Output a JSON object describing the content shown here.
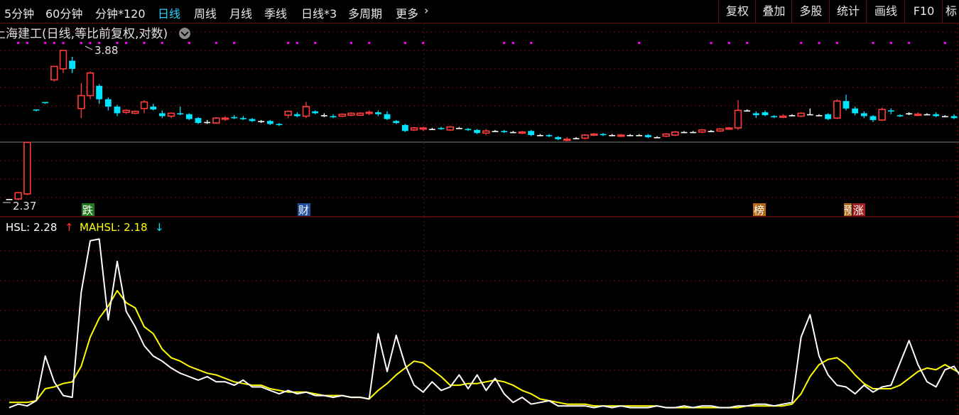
{
  "toolbar": {
    "periods": [
      "5分钟",
      "60分钟",
      "分钟*120",
      "日线",
      "周线",
      "月线",
      "季线",
      "日线*3",
      "多周期",
      "更多"
    ],
    "active": "日线",
    "more_chevron": "chevron-right-icon",
    "right_buttons": [
      "复权",
      "叠加",
      "多股",
      "统计",
      "画线",
      "F10",
      "标"
    ]
  },
  "price_panel": {
    "title": "上海建工(日线,等比前复权,对数)",
    "title_menu_icon": "chevron-down-icon",
    "high_label": "3.88",
    "low_label": "2.37",
    "markers": [
      {
        "text": "跌",
        "bg": "#1f7a1f"
      },
      {
        "text": "财",
        "bg": "#1f4f9a"
      },
      {
        "text": "榜",
        "bg": "#b06a1a"
      },
      {
        "text": "预",
        "bg": "#b06a1a"
      },
      {
        "text": "涨",
        "bg": "#a02020"
      }
    ]
  },
  "indicator_panel": {
    "hsl_label": "HSL: 2.28",
    "hsl_arrow": "↑",
    "mahsl_label": "MAHSL: 2.18",
    "mahsl_arrow": "↓"
  },
  "colors": {
    "up": "#ff3c3c",
    "down": "#00e5ff",
    "flat": "#ffffff",
    "hsl": "#ffffff",
    "mahsl": "#ffff00",
    "grid": "#7a0c0c",
    "dot": "#ff00ff"
  },
  "chart_data": {
    "type": "candlestick",
    "candles": [
      [
        2.37,
        2.37,
        2.37,
        2.37
      ],
      [
        2.37,
        2.42,
        2.36,
        2.41
      ],
      [
        2.41,
        2.86,
        2.4,
        2.86
      ],
      [
        3.19,
        3.18,
        3.17,
        3.19
      ],
      [
        3.27,
        3.26,
        3.25,
        3.27
      ],
      [
        3.52,
        3.68,
        3.5,
        3.65
      ],
      [
        3.65,
        3.88,
        3.6,
        3.84
      ],
      [
        3.75,
        3.65,
        3.6,
        3.8
      ],
      [
        3.2,
        3.34,
        3.1,
        3.48
      ],
      [
        3.34,
        3.6,
        3.3,
        3.62
      ],
      [
        3.45,
        3.3,
        3.25,
        3.47
      ],
      [
        3.3,
        3.22,
        3.18,
        3.32
      ],
      [
        3.22,
        3.15,
        3.12,
        3.24
      ],
      [
        3.16,
        3.18,
        3.14,
        3.19
      ],
      [
        3.15,
        3.17,
        3.14,
        3.18
      ],
      [
        3.2,
        3.27,
        3.15,
        3.29
      ],
      [
        3.22,
        3.19,
        3.18,
        3.25
      ],
      [
        3.15,
        3.12,
        3.1,
        3.18
      ],
      [
        3.12,
        3.15,
        3.1,
        3.16
      ],
      [
        3.15,
        3.14,
        3.13,
        3.22
      ],
      [
        3.14,
        3.09,
        3.08,
        3.15
      ],
      [
        3.1,
        3.05,
        3.04,
        3.11
      ],
      [
        3.06,
        3.06,
        3.04,
        3.08
      ],
      [
        3.05,
        3.1,
        3.04,
        3.11
      ],
      [
        3.09,
        3.1,
        3.07,
        3.12
      ],
      [
        3.11,
        3.1,
        3.09,
        3.13
      ],
      [
        3.1,
        3.09,
        3.08,
        3.12
      ],
      [
        3.09,
        3.07,
        3.06,
        3.1
      ],
      [
        3.07,
        3.07,
        3.05,
        3.08
      ],
      [
        3.07,
        3.04,
        3.03,
        3.08
      ],
      [
        3.04,
        3.03,
        3.02,
        3.05
      ],
      [
        3.13,
        3.17,
        3.1,
        3.18
      ],
      [
        3.14,
        3.12,
        3.11,
        3.16
      ],
      [
        3.12,
        3.22,
        3.1,
        3.27
      ],
      [
        3.17,
        3.15,
        3.14,
        3.18
      ],
      [
        3.13,
        3.13,
        3.11,
        3.15
      ],
      [
        3.12,
        3.11,
        3.1,
        3.14
      ],
      [
        3.12,
        3.14,
        3.11,
        3.15
      ],
      [
        3.13,
        3.15,
        3.12,
        3.16
      ],
      [
        3.13,
        3.15,
        3.12,
        3.16
      ],
      [
        3.15,
        3.16,
        3.13,
        3.18
      ],
      [
        3.16,
        3.14,
        3.12,
        3.18
      ],
      [
        3.14,
        3.09,
        3.08,
        3.17
      ],
      [
        3.07,
        3.05,
        3.04,
        3.08
      ],
      [
        3.03,
        2.97,
        2.96,
        3.04
      ],
      [
        2.98,
        3.0,
        2.97,
        3.01
      ],
      [
        2.99,
        3.0,
        2.97,
        3.01
      ],
      [
        2.99,
        2.99,
        2.98,
        3.0
      ],
      [
        3.0,
        2.99,
        2.98,
        3.01
      ],
      [
        2.98,
        3.01,
        2.97,
        3.02
      ],
      [
        3.0,
        3.0,
        2.99,
        3.01
      ],
      [
        2.99,
        2.98,
        2.97,
        3.0
      ],
      [
        2.98,
        2.95,
        2.94,
        2.99
      ],
      [
        2.95,
        2.97,
        2.93,
        2.99
      ],
      [
        2.97,
        2.97,
        2.96,
        2.98
      ],
      [
        2.97,
        2.96,
        2.95,
        2.98
      ],
      [
        2.96,
        2.96,
        2.95,
        2.97
      ],
      [
        2.95,
        2.96,
        2.94,
        2.97
      ],
      [
        2.97,
        2.93,
        2.92,
        2.98
      ],
      [
        2.93,
        2.93,
        2.92,
        2.94
      ],
      [
        2.93,
        2.92,
        2.91,
        2.94
      ],
      [
        2.91,
        2.89,
        2.88,
        2.92
      ],
      [
        2.88,
        2.89,
        2.87,
        2.91
      ],
      [
        2.9,
        2.9,
        2.89,
        2.91
      ],
      [
        2.9,
        2.93,
        2.89,
        2.94
      ],
      [
        2.93,
        2.94,
        2.92,
        2.95
      ],
      [
        2.94,
        2.93,
        2.92,
        2.95
      ],
      [
        2.93,
        2.93,
        2.92,
        2.94
      ],
      [
        2.92,
        2.93,
        2.91,
        2.94
      ],
      [
        2.93,
        2.93,
        2.92,
        2.94
      ],
      [
        2.93,
        2.93,
        2.92,
        2.94
      ],
      [
        2.93,
        2.91,
        2.9,
        2.94
      ],
      [
        2.91,
        2.91,
        2.9,
        2.92
      ],
      [
        2.92,
        2.94,
        2.91,
        2.95
      ],
      [
        2.93,
        2.96,
        2.92,
        2.97
      ],
      [
        2.96,
        2.96,
        2.95,
        2.97
      ],
      [
        2.96,
        2.96,
        2.95,
        2.97
      ],
      [
        2.96,
        2.98,
        2.95,
        2.99
      ],
      [
        2.97,
        2.97,
        2.96,
        2.98
      ],
      [
        2.97,
        2.99,
        2.96,
        3.0
      ],
      [
        2.99,
        3.0,
        2.98,
        3.01
      ],
      [
        3.0,
        3.18,
        2.98,
        3.29
      ],
      [
        3.18,
        3.18,
        3.17,
        3.19
      ],
      [
        3.15,
        3.13,
        3.1,
        3.17
      ],
      [
        3.16,
        3.13,
        3.12,
        3.18
      ],
      [
        3.12,
        3.11,
        3.1,
        3.13
      ],
      [
        3.11,
        3.12,
        3.1,
        3.14
      ],
      [
        3.13,
        3.13,
        3.12,
        3.14
      ],
      [
        3.12,
        3.15,
        3.11,
        3.16
      ],
      [
        3.14,
        3.14,
        3.13,
        3.2
      ],
      [
        3.13,
        3.13,
        3.12,
        3.14
      ],
      [
        3.14,
        3.09,
        3.08,
        3.15
      ],
      [
        3.1,
        3.28,
        3.09,
        3.3
      ],
      [
        3.28,
        3.2,
        3.18,
        3.35
      ],
      [
        3.2,
        3.15,
        3.13,
        3.22
      ],
      [
        3.15,
        3.12,
        3.1,
        3.17
      ],
      [
        3.12,
        3.08,
        3.06,
        3.13
      ],
      [
        3.08,
        3.19,
        3.07,
        3.21
      ],
      [
        3.18,
        3.17,
        3.14,
        3.2
      ],
      [
        3.13,
        3.12,
        3.11,
        3.14
      ],
      [
        3.15,
        3.15,
        3.13,
        3.16
      ],
      [
        3.13,
        3.14,
        3.12,
        3.16
      ],
      [
        3.14,
        3.14,
        3.13,
        3.15
      ],
      [
        3.14,
        3.12,
        3.11,
        3.16
      ],
      [
        3.12,
        3.12,
        3.11,
        3.13
      ],
      [
        3.12,
        3.1,
        3.09,
        3.14
      ]
    ],
    "indicator": {
      "hsl": [
        0.1,
        0.3,
        0.2,
        0.5,
        3.1,
        1.6,
        0.8,
        0.7,
        6.8,
        9.8,
        9.9,
        5.2,
        8.6,
        5.7,
        4.8,
        3.7,
        3.1,
        2.8,
        2.4,
        2.1,
        1.9,
        1.7,
        1.9,
        1.6,
        1.6,
        1.4,
        1.7,
        1.3,
        1.3,
        1.1,
        0.9,
        1.1,
        0.9,
        1.0,
        0.8,
        0.8,
        0.7,
        0.8,
        0.7,
        0.7,
        0.6,
        4.4,
        2.2,
        4.3,
        2.6,
        1.4,
        1.0,
        1.6,
        1.1,
        1.3,
        2.0,
        1.2,
        2.0,
        1.1,
        1.8,
        0.9,
        0.4,
        0.7,
        0.3,
        0.4,
        0.5,
        0.2,
        0.2,
        0.2,
        0.2,
        0.1,
        0.2,
        0.1,
        0.2,
        0.1,
        0.1,
        0.1,
        0.2,
        0.1,
        0.1,
        0.2,
        0.1,
        0.2,
        0.2,
        0.1,
        0.1,
        0.2,
        0.2,
        0.3,
        0.3,
        0.2,
        0.3,
        0.4,
        4.2,
        5.5,
        3.1,
        2.0,
        1.4,
        1.3,
        0.9,
        1.4,
        1.0,
        1.3,
        1.4,
        2.7,
        4.0,
        2.6,
        1.6,
        1.3,
        2.3,
        2.5,
        1.7,
        0.9,
        0.5,
        0.3
      ],
      "mahsl": [
        0.4,
        0.4,
        0.4,
        0.5,
        1.2,
        1.3,
        1.5,
        1.6,
        2.5,
        4.2,
        5.3,
        6.0,
        6.9,
        6.2,
        5.9,
        4.8,
        4.4,
        3.5,
        3.0,
        2.8,
        2.5,
        2.3,
        2.1,
        2.0,
        1.8,
        1.6,
        1.5,
        1.4,
        1.4,
        1.2,
        1.1,
        1.0,
        1.0,
        1.0,
        0.9,
        0.8,
        0.8,
        0.8,
        0.7,
        0.7,
        0.6,
        1.1,
        1.5,
        2.0,
        2.4,
        2.8,
        2.7,
        2.3,
        1.9,
        1.4,
        1.4,
        1.5,
        1.5,
        1.6,
        1.7,
        1.6,
        1.4,
        1.1,
        0.9,
        0.6,
        0.5,
        0.4,
        0.3,
        0.3,
        0.3,
        0.2,
        0.2,
        0.2,
        0.2,
        0.2,
        0.2,
        0.2,
        0.2,
        0.1,
        0.1,
        0.1,
        0.1,
        0.1,
        0.1,
        0.1,
        0.1,
        0.1,
        0.2,
        0.2,
        0.2,
        0.2,
        0.2,
        0.3,
        0.9,
        1.9,
        2.6,
        2.9,
        3.0,
        2.6,
        2.0,
        1.5,
        1.2,
        1.2,
        1.2,
        1.4,
        1.8,
        2.2,
        2.4,
        2.3,
        2.6,
        2.3,
        2.0,
        1.7,
        1.3,
        0.9
      ]
    },
    "title": "上海建工(日线,等比前复权,对数)",
    "xlabel": "",
    "ylabel": "",
    "grid": true
  }
}
